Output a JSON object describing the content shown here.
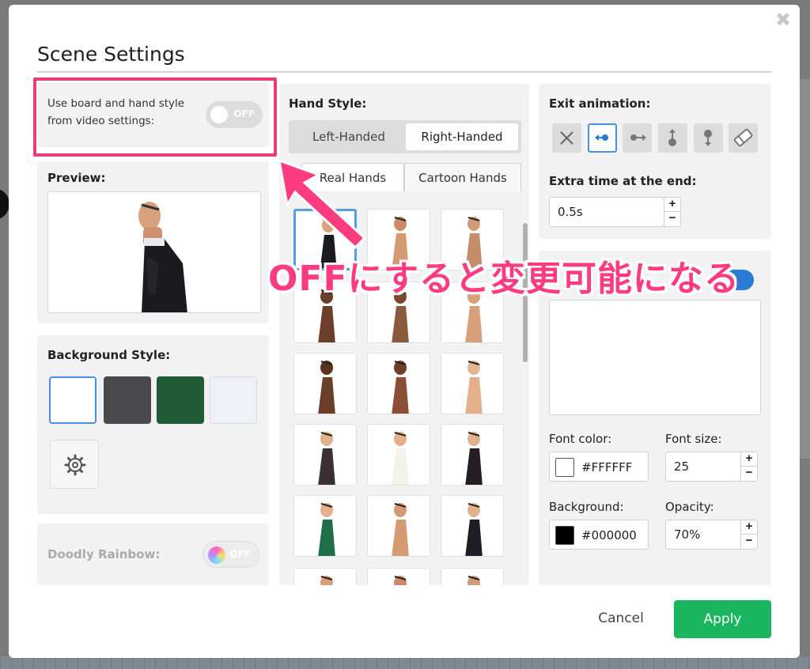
{
  "dialog": {
    "title": "Scene Settings",
    "close_glyph": "✖"
  },
  "use_board": {
    "label": "Use board and hand style from video settings:",
    "toggle_text": "OFF"
  },
  "preview": {
    "label": "Preview:"
  },
  "background_style": {
    "label": "Background Style:",
    "swatches": [
      "#ffffff",
      "#4a4a4e",
      "#1f5c36",
      "#eef1f8"
    ],
    "selected_index": 0,
    "settings_icon": "gear-icon"
  },
  "doodly_rainbow": {
    "label": "Doodly Rainbow:",
    "toggle_text": "OFF"
  },
  "hand_style": {
    "label": "Hand Style:",
    "options": [
      "Left-Handed",
      "Right-Handed"
    ],
    "selected": "Right-Handed",
    "tabs": [
      "Real Hands",
      "Cartoon Hands"
    ],
    "active_tab": "Real Hands"
  },
  "exit_animation": {
    "label": "Exit animation:",
    "buttons": [
      "none-icon",
      "slide-left-icon",
      "slide-right-icon",
      "pin-up-icon",
      "pin-down-icon",
      "eraser-icon"
    ],
    "selected_index": 1
  },
  "extra_time": {
    "label": "Extra time at the end:",
    "value": "0.5s"
  },
  "text_settings": {
    "font_color_label": "Font color:",
    "font_color_value": "#FFFFFF",
    "font_size_label": "Font size:",
    "font_size_value": "25",
    "background_label": "Background:",
    "background_value": "#000000",
    "opacity_label": "Opacity:",
    "opacity_value": "70%"
  },
  "footer": {
    "cancel": "Cancel",
    "apply": "Apply"
  },
  "annotation": {
    "text": "OFFにすると変更可能になる"
  },
  "colors": {
    "accent": "#4a90e2",
    "apply": "#19b55f",
    "annotation": "#ff3b7f"
  }
}
